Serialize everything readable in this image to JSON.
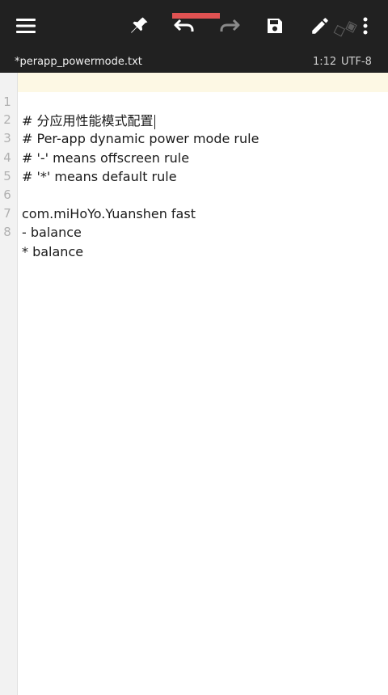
{
  "toolbar": {
    "icons": [
      "menu-icon",
      "pin-icon",
      "undo-icon",
      "redo-icon",
      "save-icon",
      "edit-icon",
      "more-vert-icon"
    ],
    "background": "#212121",
    "highlight_color": "#e05252"
  },
  "file": {
    "name": "*perapp_powermode.txt",
    "position": "1:12",
    "encoding": "UTF-8"
  },
  "editor": {
    "lines": [
      {
        "num": "1",
        "text": "# 分应用性能模式配置"
      },
      {
        "num": "2",
        "text": "# Per-app dynamic power mode rule"
      },
      {
        "num": "3",
        "text": "# '-' means offscreen rule"
      },
      {
        "num": "4",
        "text": "# '*' means default rule"
      },
      {
        "num": "5",
        "text": ""
      },
      {
        "num": "6",
        "text": "com.miHoYo.Yuanshen fast"
      },
      {
        "num": "7",
        "text": "- balance"
      },
      {
        "num": "8",
        "text": "* balance"
      }
    ]
  }
}
